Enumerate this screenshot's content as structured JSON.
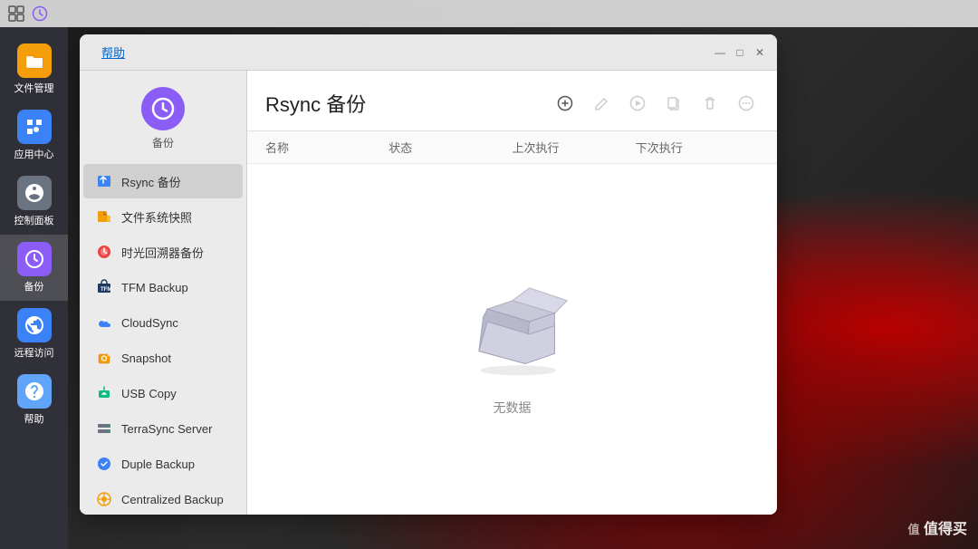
{
  "taskbar": {
    "icons": [
      "window-icon",
      "clock-icon"
    ]
  },
  "dock": {
    "items": [
      {
        "id": "file-manager",
        "label": "文件管理",
        "iconColor": "file",
        "icon": "📁"
      },
      {
        "id": "app-center",
        "label": "应用中心",
        "iconColor": "app",
        "icon": "🛍️"
      },
      {
        "id": "control-panel",
        "label": "控制面板",
        "iconColor": "ctrl",
        "icon": "⚙️"
      },
      {
        "id": "backup",
        "label": "备份",
        "iconColor": "backup",
        "icon": "🕐"
      },
      {
        "id": "remote-access",
        "label": "远程访问",
        "iconColor": "remote",
        "icon": "🌐"
      },
      {
        "id": "help",
        "label": "帮助",
        "iconColor": "help",
        "icon": "❓"
      }
    ]
  },
  "window": {
    "title": "Rsync 备份",
    "help_label": "帮助",
    "sidebar": {
      "app_label": "备份",
      "items": [
        {
          "id": "rsync-backup",
          "label": "Rsync 备份",
          "icon": "rsync",
          "active": true
        },
        {
          "id": "file-snapshot",
          "label": "文件系统快照",
          "icon": "snapshot-file"
        },
        {
          "id": "time-machine",
          "label": "时光回溯器备份",
          "icon": "time-machine"
        },
        {
          "id": "tfm-backup",
          "label": "TFM Backup",
          "icon": "tfm"
        },
        {
          "id": "cloud-sync",
          "label": "CloudSync",
          "icon": "cloud"
        },
        {
          "id": "snapshot",
          "label": "Snapshot",
          "icon": "snapshot"
        },
        {
          "id": "usb-copy",
          "label": "USB Copy",
          "icon": "usb"
        },
        {
          "id": "terrasync-server",
          "label": "TerraSync Server",
          "icon": "terrasync"
        },
        {
          "id": "duple-backup",
          "label": "Duple Backup",
          "icon": "duple"
        },
        {
          "id": "centralized-backup",
          "label": "Centralized Backup",
          "icon": "centralized"
        }
      ]
    },
    "table": {
      "columns": [
        "名称",
        "状态",
        "上次执行",
        "下次执行"
      ]
    },
    "toolbar": {
      "buttons": [
        "add",
        "edit",
        "play",
        "copy",
        "delete",
        "more"
      ]
    },
    "empty": {
      "label": "无数据"
    }
  },
  "watermark": "值得买"
}
